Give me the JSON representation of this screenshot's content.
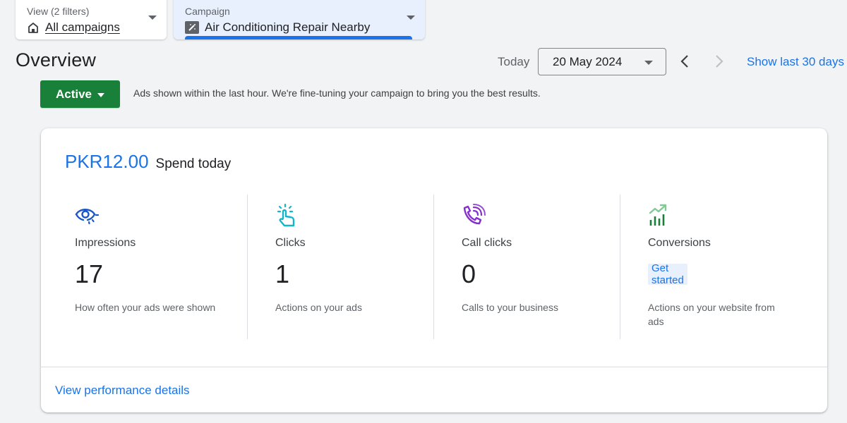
{
  "filters": {
    "view": {
      "label": "View (2 filters)",
      "value": "All campaigns",
      "icon": "home-icon"
    },
    "campaign": {
      "label": "Campaign",
      "value": "Air Conditioning Repair Nearby",
      "icon": "smart-campaign-icon"
    }
  },
  "header": {
    "title": "Overview",
    "today_label": "Today",
    "date_value": "20 May 2024",
    "show_last_label": "Show last 30 days"
  },
  "status": {
    "label": "Active",
    "message": "Ads shown within the last hour. We're fine-tuning your campaign to bring you the best results."
  },
  "card": {
    "spend_amount": "PKR12.00",
    "spend_label": "Spend today",
    "metrics": [
      {
        "icon": "eye-icon",
        "name": "Impressions",
        "value": "17",
        "description": "How often your ads were shown",
        "color": "#1a55c9"
      },
      {
        "icon": "tap-icon",
        "name": "Clicks",
        "value": "1",
        "description": "Actions on your ads",
        "color": "#12b5cb"
      },
      {
        "icon": "phone-call-icon",
        "name": "Call clicks",
        "value": "0",
        "description": "Calls to your business",
        "color": "#8430ce"
      },
      {
        "icon": "conversion-chart-icon",
        "name": "Conversions",
        "action_label": "Get started",
        "description": "Actions on your website from ads",
        "color": "#188038"
      }
    ],
    "performance_link": "View performance details"
  },
  "colors": {
    "accent": "#1a73e8",
    "active_green": "#188038",
    "background": "#f1f3f4"
  }
}
